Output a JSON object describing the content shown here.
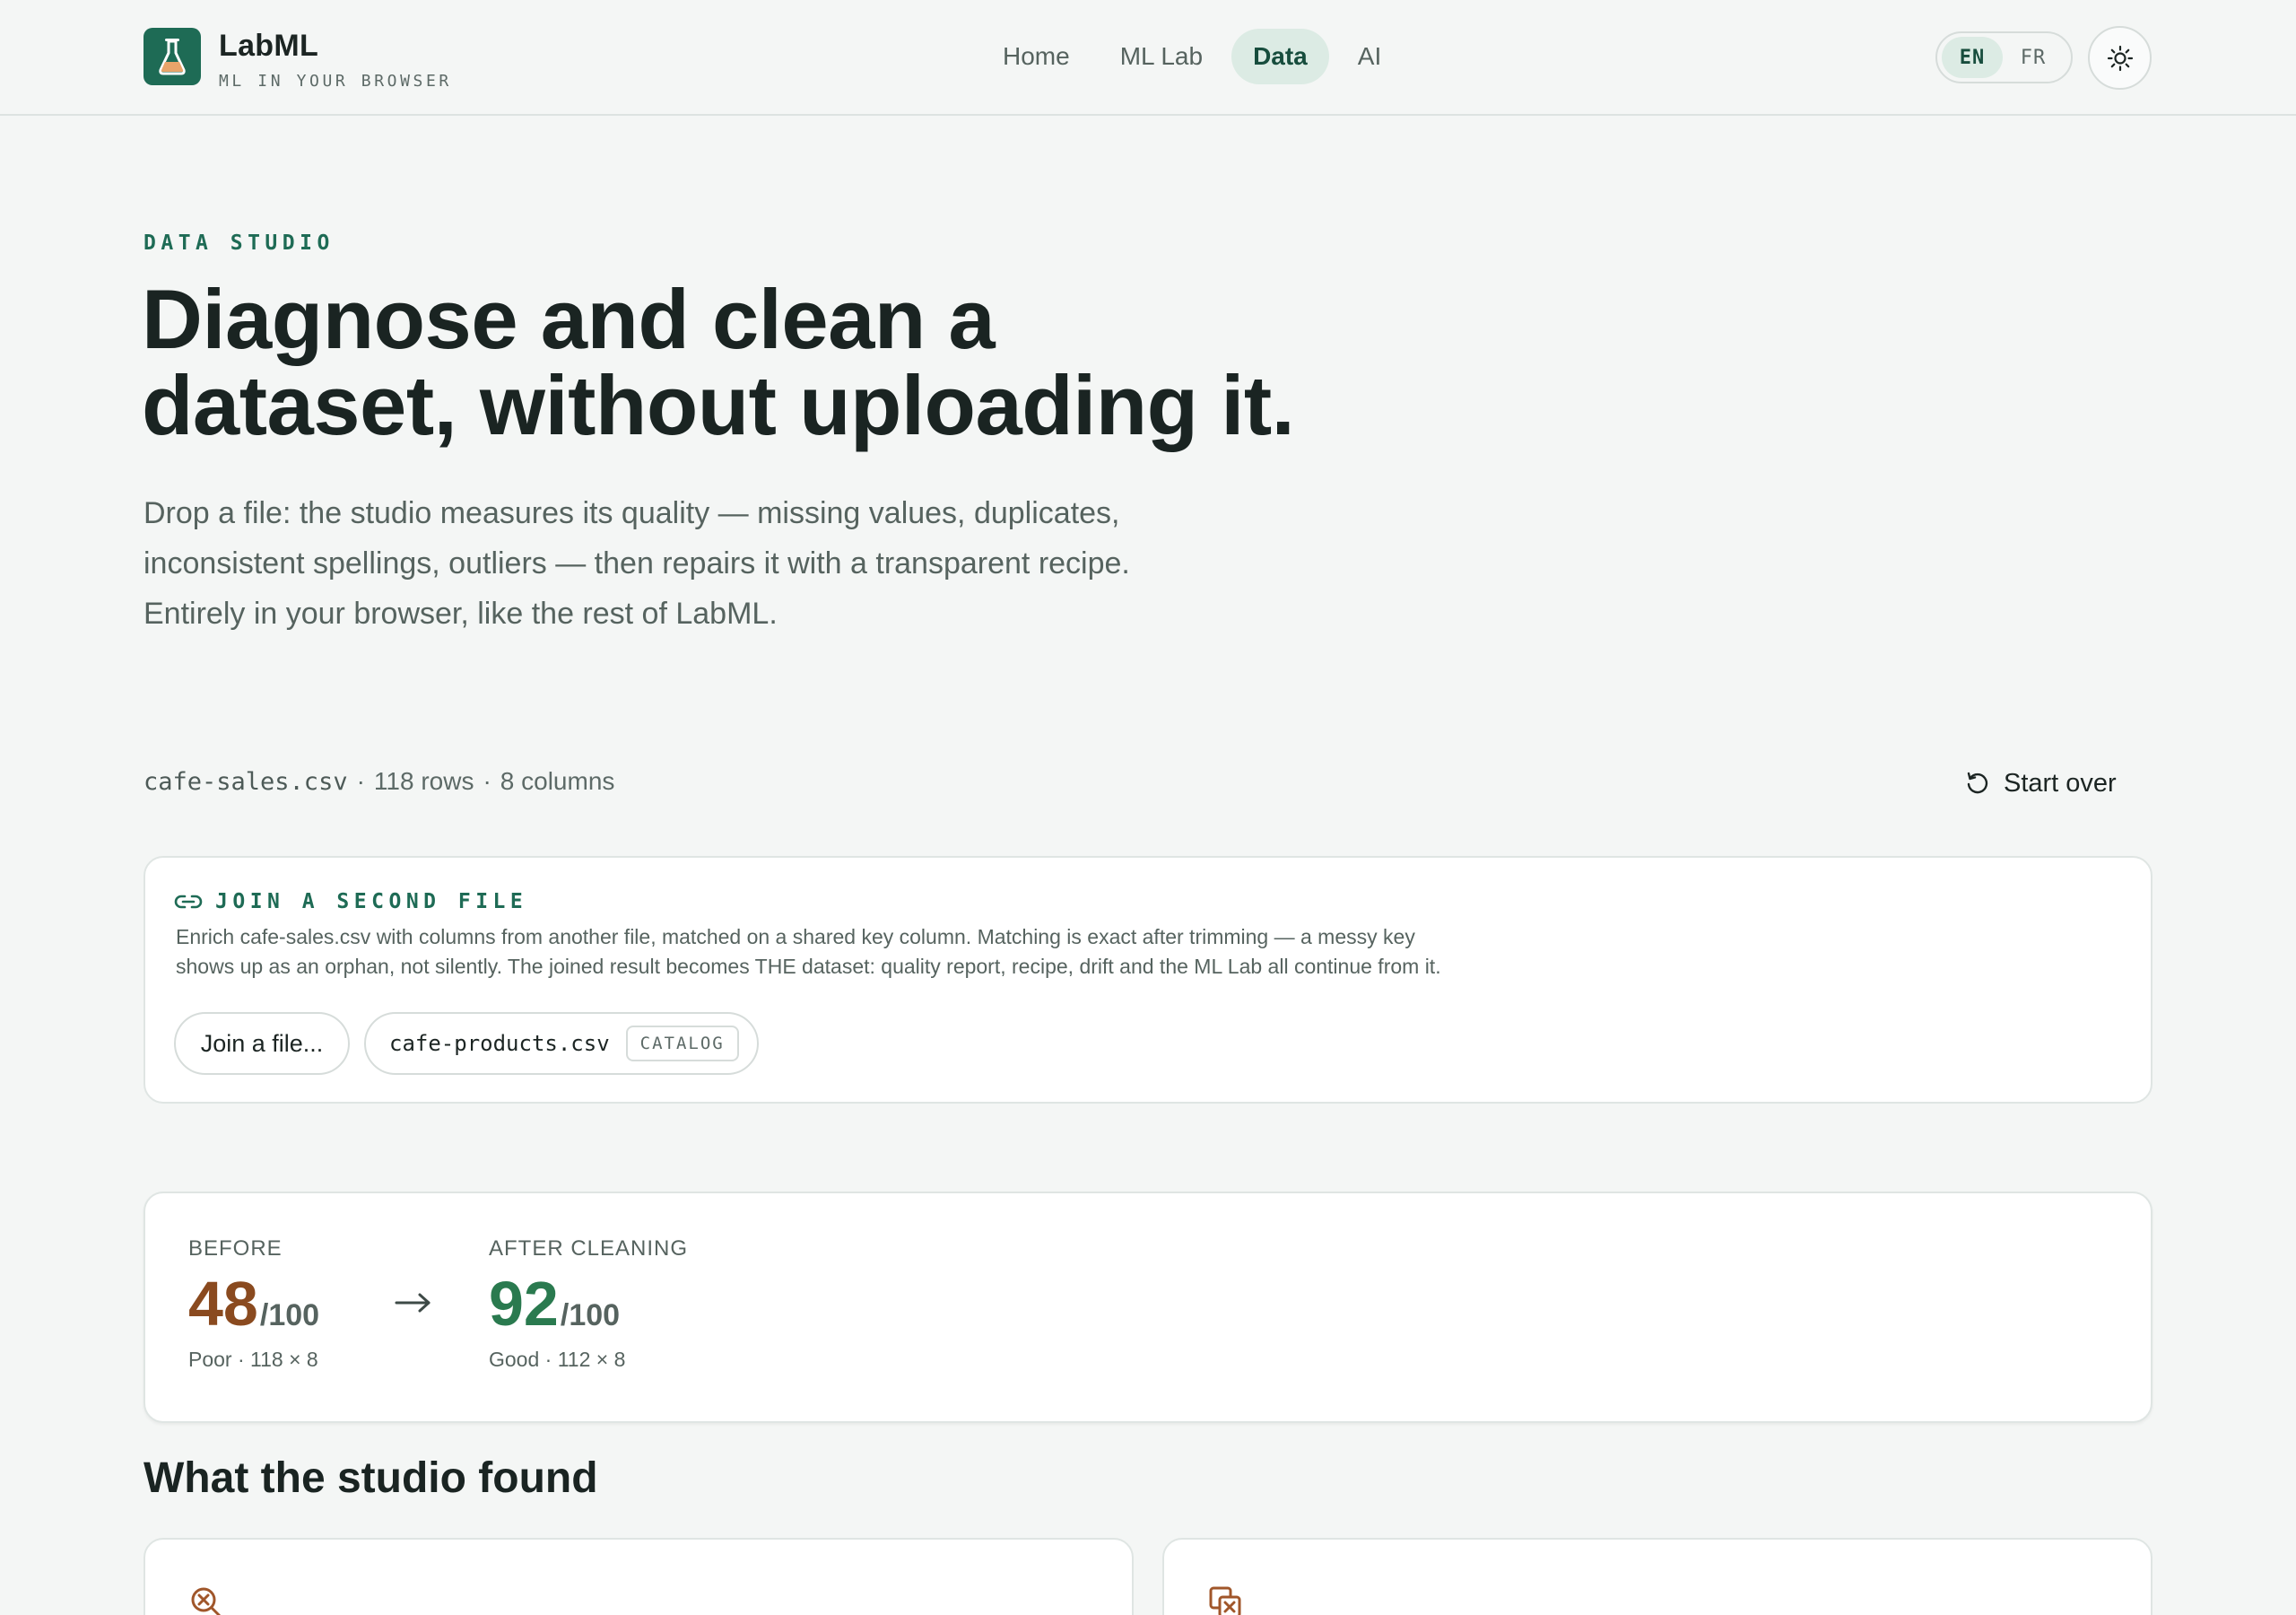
{
  "header": {
    "brand_name": "LabML",
    "brand_tagline": "ML IN YOUR BROWSER",
    "nav": [
      {
        "label": "Home",
        "active": false
      },
      {
        "label": "ML Lab",
        "active": false
      },
      {
        "label": "Data",
        "active": true
      },
      {
        "label": "AI",
        "active": false
      }
    ],
    "languages": [
      {
        "label": "EN",
        "active": true
      },
      {
        "label": "FR",
        "active": false
      }
    ],
    "theme_toggle_icon": "sun-icon"
  },
  "hero": {
    "eyebrow": "DATA STUDIO",
    "title_line1": "Diagnose and clean a",
    "title_line2": "dataset, without uploading it.",
    "subtitle_line1": "Drop a file: the studio measures its quality — missing values, duplicates,",
    "subtitle_line2": "inconsistent spellings, outliers — then repairs it with a transparent recipe.",
    "subtitle_line3": "Entirely in your browser, like the rest of LabML."
  },
  "file": {
    "name": "cafe-sales.csv",
    "rows": "118 rows",
    "columns": "8 columns",
    "separator": "·",
    "start_over_label": "Start over"
  },
  "join": {
    "title": "JOIN A SECOND FILE",
    "desc_line1": "Enrich cafe-sales.csv with columns from another file, matched on a shared key column. Matching is exact after trimming — a messy key",
    "desc_line2": "shows up as an orphan, not silently. The joined result becomes THE dataset: quality report, recipe, drift and the ML Lab all continue from it.",
    "join_button_label": "Join a file...",
    "suggested_file": "cafe-products.csv",
    "suggested_tag": "CATALOG"
  },
  "score": {
    "before_label": "BEFORE",
    "before_value": "48",
    "before_denominator": "/100",
    "before_meta": "Poor · 118 × 8",
    "after_label": "AFTER CLEANING",
    "after_value": "92",
    "after_denominator": "/100",
    "after_meta": "Good · 112 × 8",
    "before_color": "#8a4a1f",
    "after_color": "#2a7a4f"
  },
  "found": {
    "title": "What the studio found"
  },
  "colors": {
    "accent": "#1e6b55",
    "background": "#f4f6f5",
    "warning": "#a0562a"
  }
}
